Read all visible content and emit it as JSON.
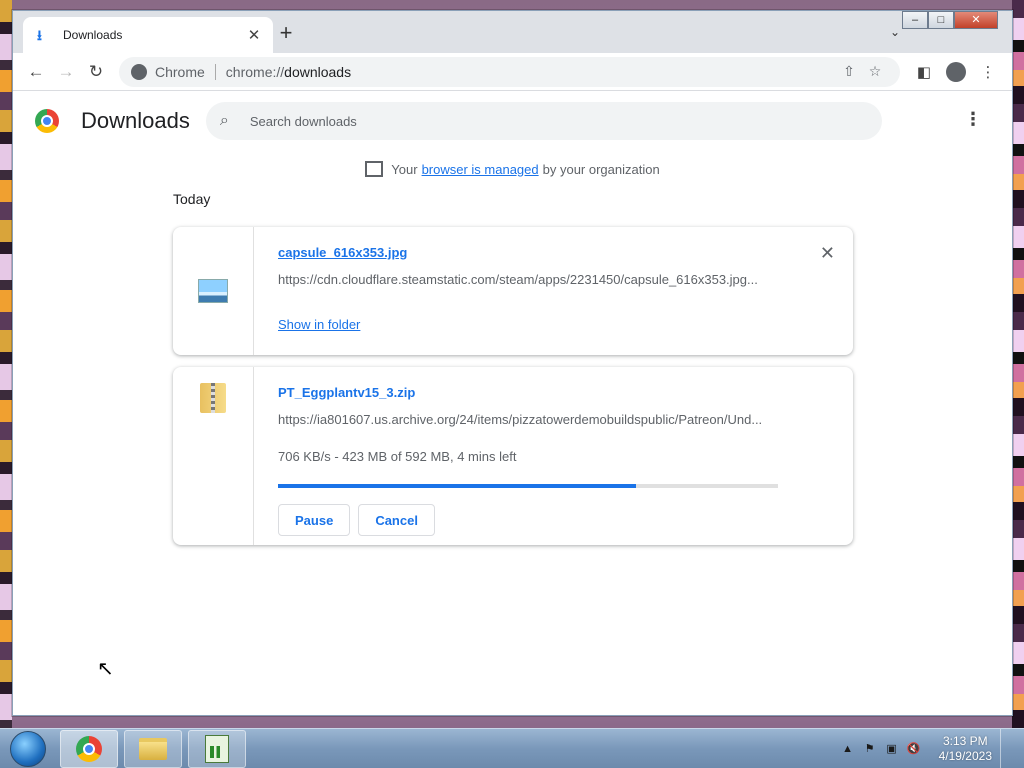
{
  "browser": {
    "tab_title": "Downloads",
    "address_site": "Chrome",
    "address_scheme": "chrome://",
    "address_path": "downloads"
  },
  "page": {
    "title": "Downloads",
    "search_placeholder": "Search downloads",
    "managed_prefix": "Your",
    "managed_link": "browser is managed",
    "managed_suffix": "by your organization",
    "date_group": "Today"
  },
  "downloads": [
    {
      "file_name": "capsule_616x353.jpg",
      "url": "https://cdn.cloudflare.steamstatic.com/steam/apps/2231450/capsule_616x353.jpg...",
      "action_link": "Show in folder",
      "icon": "image-file-icon"
    },
    {
      "file_name": "PT_Eggplantv15_3.zip",
      "url": "https://ia801607.us.archive.org/24/items/pizzatowerdemobuildspublic/Patreon/Und...",
      "status": "706 KB/s - 423 MB of 592 MB, 4 mins left",
      "progress": 0.715,
      "pause_label": "Pause",
      "cancel_label": "Cancel",
      "icon": "zip-file-icon"
    }
  ],
  "taskbar": {
    "time": "3:13 PM",
    "date": "4/19/2023"
  }
}
